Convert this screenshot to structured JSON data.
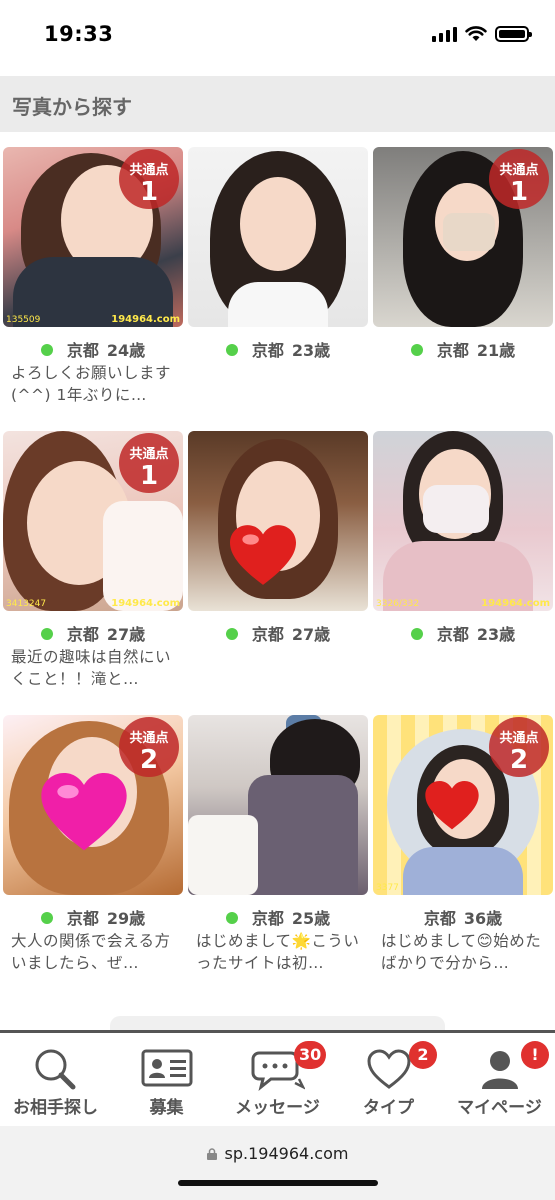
{
  "status_bar": {
    "time": "19:33"
  },
  "section": {
    "title": "写真から探す"
  },
  "profiles": [
    {
      "location": "京都",
      "age": "24歳",
      "online": true,
      "common_label": "共通点",
      "common_count": "1",
      "watermark": "194964.com",
      "id_mark": "135509",
      "intro": "よろしくお願いします(^^) 1年ぶりに…"
    },
    {
      "location": "京都",
      "age": "23歳",
      "online": true,
      "intro": ""
    },
    {
      "location": "京都",
      "age": "21歳",
      "online": true,
      "common_label": "共通点",
      "common_count": "1",
      "intro": ""
    },
    {
      "location": "京都",
      "age": "27歳",
      "online": true,
      "common_label": "共通点",
      "common_count": "1",
      "watermark": "194964.com",
      "id_mark": "3413247",
      "intro": "最近の趣味は自然にいくこと！！滝と…"
    },
    {
      "location": "京都",
      "age": "27歳",
      "online": true,
      "intro": ""
    },
    {
      "location": "京都",
      "age": "23歳",
      "online": true,
      "watermark": "194964.com",
      "id_mark": "3326/332",
      "intro": ""
    },
    {
      "location": "京都",
      "age": "29歳",
      "online": true,
      "common_label": "共通点",
      "common_count": "2",
      "intro": "大人の関係で会える方いましたら、ぜ…"
    },
    {
      "location": "京都",
      "age": "25歳",
      "online": true,
      "intro": "はじめまして🌟こういったサイトは初…"
    },
    {
      "location": "京都",
      "age": "36歳",
      "online": false,
      "common_label": "共通点",
      "common_count": "2",
      "id_mark": "3377",
      "intro": "はじめまして😊始めたばかりで分から…"
    }
  ],
  "nav": {
    "items": [
      {
        "label": "お相手探し",
        "icon": "search-icon"
      },
      {
        "label": "募集",
        "icon": "id-card-icon"
      },
      {
        "label": "メッセージ",
        "icon": "chat-icon",
        "badge": "30"
      },
      {
        "label": "タイプ",
        "icon": "heart-icon",
        "badge": "2"
      },
      {
        "label": "マイページ",
        "icon": "person-icon",
        "badge": "!"
      }
    ]
  },
  "browser": {
    "url": "sp.194964.com"
  },
  "colors": {
    "online": "#55d04a",
    "badge": "#e0312f",
    "common_badge": "#be2828"
  }
}
